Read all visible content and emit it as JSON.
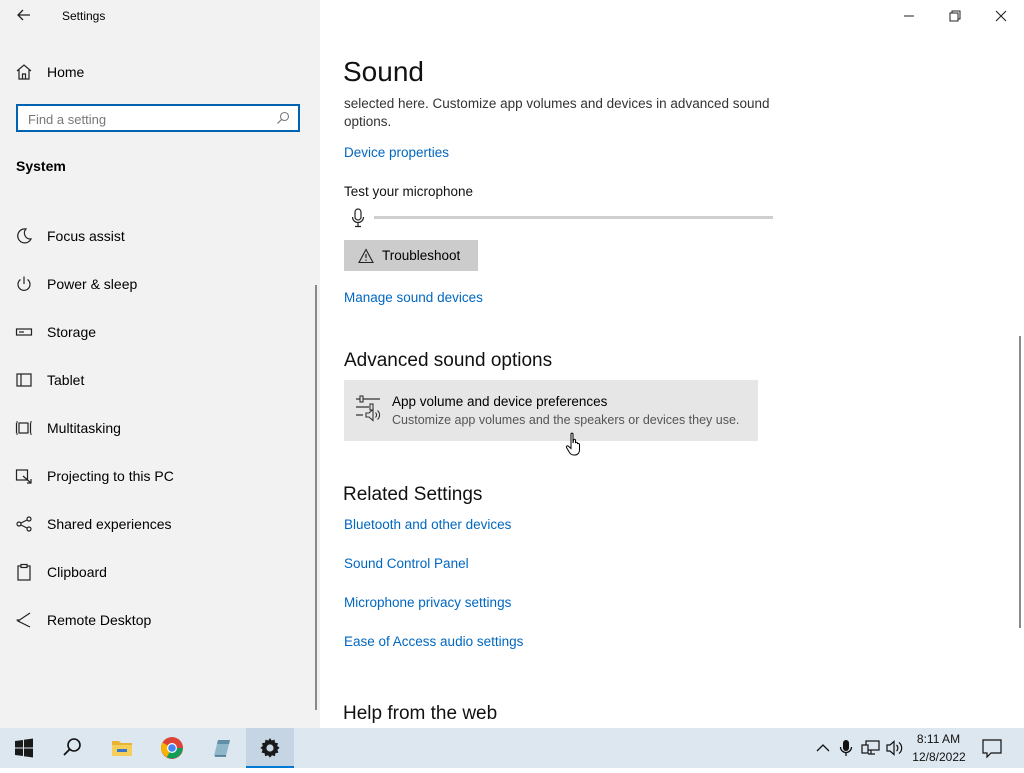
{
  "app_title": "Settings",
  "sidebar": {
    "home_label": "Home",
    "search_placeholder": "Find a setting",
    "section": "System",
    "items": [
      {
        "label": "Focus assist"
      },
      {
        "label": "Power & sleep"
      },
      {
        "label": "Storage"
      },
      {
        "label": "Tablet"
      },
      {
        "label": "Multitasking"
      },
      {
        "label": "Projecting to this PC"
      },
      {
        "label": "Shared experiences"
      },
      {
        "label": "Clipboard"
      },
      {
        "label": "Remote Desktop"
      }
    ]
  },
  "main": {
    "title": "Sound",
    "intro_line1": "selected here. Customize app volumes and devices in advanced sound",
    "intro_line2": "options.",
    "device_properties": "Device properties",
    "test_mic": "Test your microphone",
    "mic_level": 0,
    "troubleshoot": "Troubleshoot",
    "manage_devices": "Manage sound devices",
    "advanced_heading": "Advanced sound options",
    "app_volume_title": "App volume and device preferences",
    "app_volume_desc": "Customize app volumes and the speakers or devices they use.",
    "related_heading": "Related Settings",
    "related_links": [
      "Bluetooth and other devices",
      "Sound Control Panel",
      "Microphone privacy settings",
      "Ease of Access audio settings"
    ],
    "help_heading": "Help from the web"
  },
  "taskbar": {
    "time": "8:11 AM",
    "date": "12/8/2022"
  },
  "colors": {
    "accent": "#0078d4",
    "link": "#0067c0",
    "sidebar_bg": "#f2f2f2",
    "taskbar_bg": "#dde7f0"
  }
}
